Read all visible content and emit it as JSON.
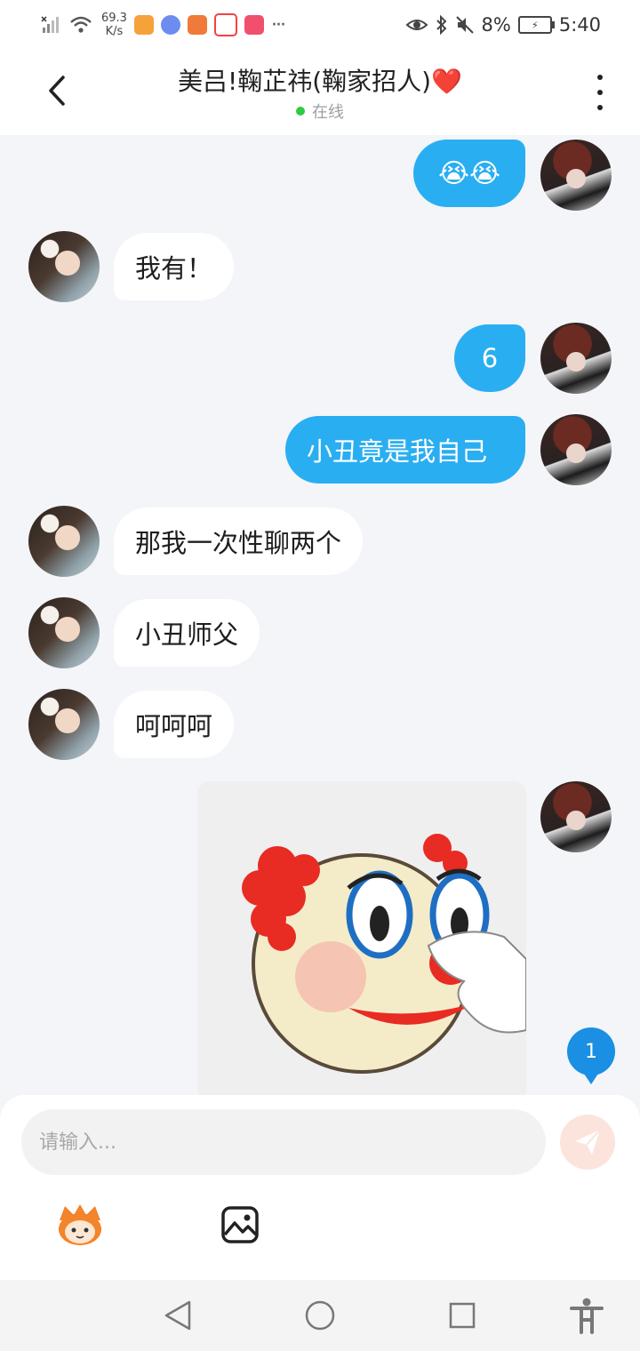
{
  "status_bar": {
    "network_speed_value": "69.3",
    "network_speed_unit": "K/s",
    "more_notifications": "···",
    "battery_percent": "8%",
    "time": "5:40"
  },
  "header": {
    "title": "美吕!鞠芷祎(鞠家招人)❤️",
    "status": "在线"
  },
  "messages": [
    {
      "side": "out",
      "text": "😭😭"
    },
    {
      "side": "in",
      "text": "我有！"
    },
    {
      "side": "out",
      "text": "6"
    },
    {
      "side": "out",
      "text": "小丑竟是我自己"
    },
    {
      "side": "in",
      "text": "那我一次性聊两个"
    },
    {
      "side": "in",
      "text": "小丑师父"
    },
    {
      "side": "in",
      "text": "呵呵呵"
    },
    {
      "side": "out",
      "type": "sticker",
      "sticker": "clown-face"
    }
  ],
  "unread_count": "1",
  "input": {
    "placeholder": "请输入...",
    "value": ""
  },
  "colors": {
    "outgoing_bubble": "#2aaef2",
    "incoming_bubble": "#ffffff",
    "background": "#f3f5f9",
    "online_dot": "#2ecc40",
    "badge": "#1a8fe3"
  }
}
